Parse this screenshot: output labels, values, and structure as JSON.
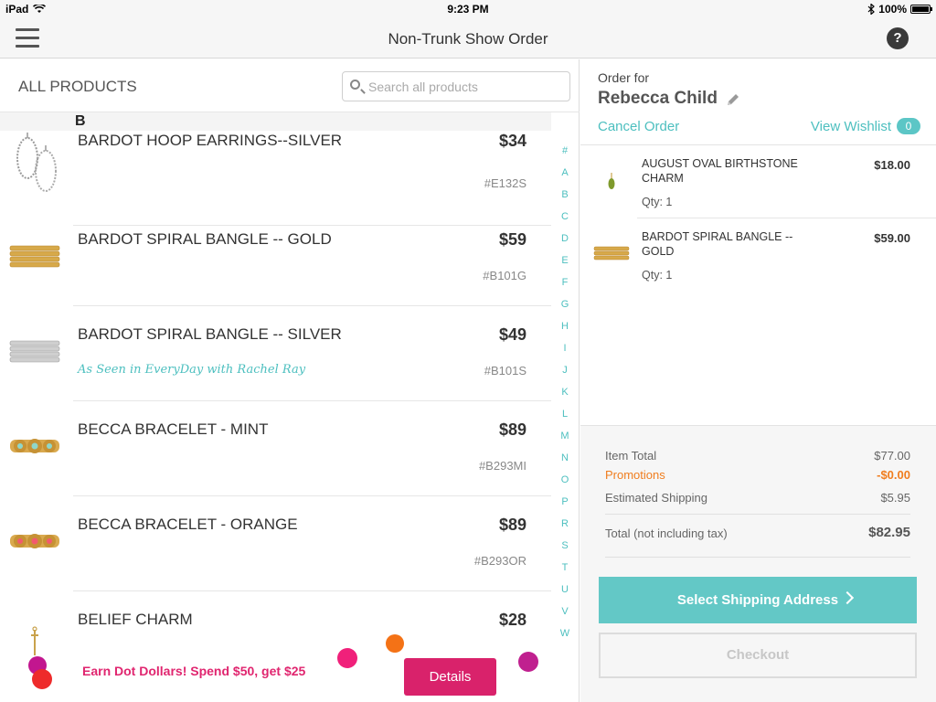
{
  "status_bar": {
    "device": "iPad",
    "time": "9:23 PM",
    "battery": "100%"
  },
  "navbar": {
    "title": "Non-Trunk Show Order",
    "help_label": "?"
  },
  "products_panel": {
    "title": "ALL PRODUCTS",
    "search_placeholder": "Search all products",
    "section_letter": "B",
    "items": [
      {
        "name": "BARDOT HOOP EARRINGS--SILVER",
        "price": "$34",
        "sku": "#E132S",
        "tagline": "",
        "icon": "hoop-earrings-icon"
      },
      {
        "name": "BARDOT SPIRAL BANGLE -- GOLD",
        "price": "$59",
        "sku": "#B101G",
        "tagline": "",
        "icon": "gold-bangle-icon"
      },
      {
        "name": "BARDOT SPIRAL BANGLE -- SILVER",
        "price": "$49",
        "sku": "#B101S",
        "tagline": "As Seen in EveryDay with Rachel Ray",
        "icon": "silver-bangle-icon"
      },
      {
        "name": "BECCA BRACELET - MINT",
        "price": "$89",
        "sku": "#B293MI",
        "tagline": "",
        "icon": "mint-bracelet-icon"
      },
      {
        "name": "BECCA BRACELET - ORANGE",
        "price": "$89",
        "sku": "#B293OR",
        "tagline": "",
        "icon": "orange-bracelet-icon"
      },
      {
        "name": "BELIEF CHARM",
        "price": "$28",
        "sku": "",
        "tagline": "",
        "icon": "charm-icon"
      }
    ],
    "alpha_index": [
      "#",
      "A",
      "B",
      "C",
      "D",
      "E",
      "F",
      "G",
      "H",
      "I",
      "J",
      "K",
      "L",
      "M",
      "N",
      "O",
      "P",
      "R",
      "S",
      "T",
      "U",
      "V",
      "W"
    ]
  },
  "promo": {
    "text": "Earn Dot Dollars! Spend $50, get $25",
    "button": "Details"
  },
  "order": {
    "label": "Order for",
    "customer": "Rebecca Child",
    "cancel": "Cancel Order",
    "wishlist_label": "View Wishlist",
    "wishlist_count": "0",
    "items": [
      {
        "name": "AUGUST OVAL BIRTHSTONE CHARM",
        "price": "$18.00",
        "qty": "Qty: 1"
      },
      {
        "name": "BARDOT SPIRAL BANGLE -- GOLD",
        "price": "$59.00",
        "qty": "Qty: 1"
      }
    ],
    "totals": {
      "item_total_label": "Item Total",
      "item_total": "$77.00",
      "promotions_label": "Promotions",
      "promotions": "-$0.00",
      "shipping_label": "Estimated Shipping",
      "shipping": "$5.95",
      "total_label": "Total (not including tax)",
      "total": "$82.95"
    },
    "ship_button": "Select Shipping Address",
    "checkout_button": "Checkout"
  },
  "colors": {
    "accent": "#4cbfbf",
    "promo_pink": "#d9226b",
    "promo_orange": "#f07d1e"
  }
}
